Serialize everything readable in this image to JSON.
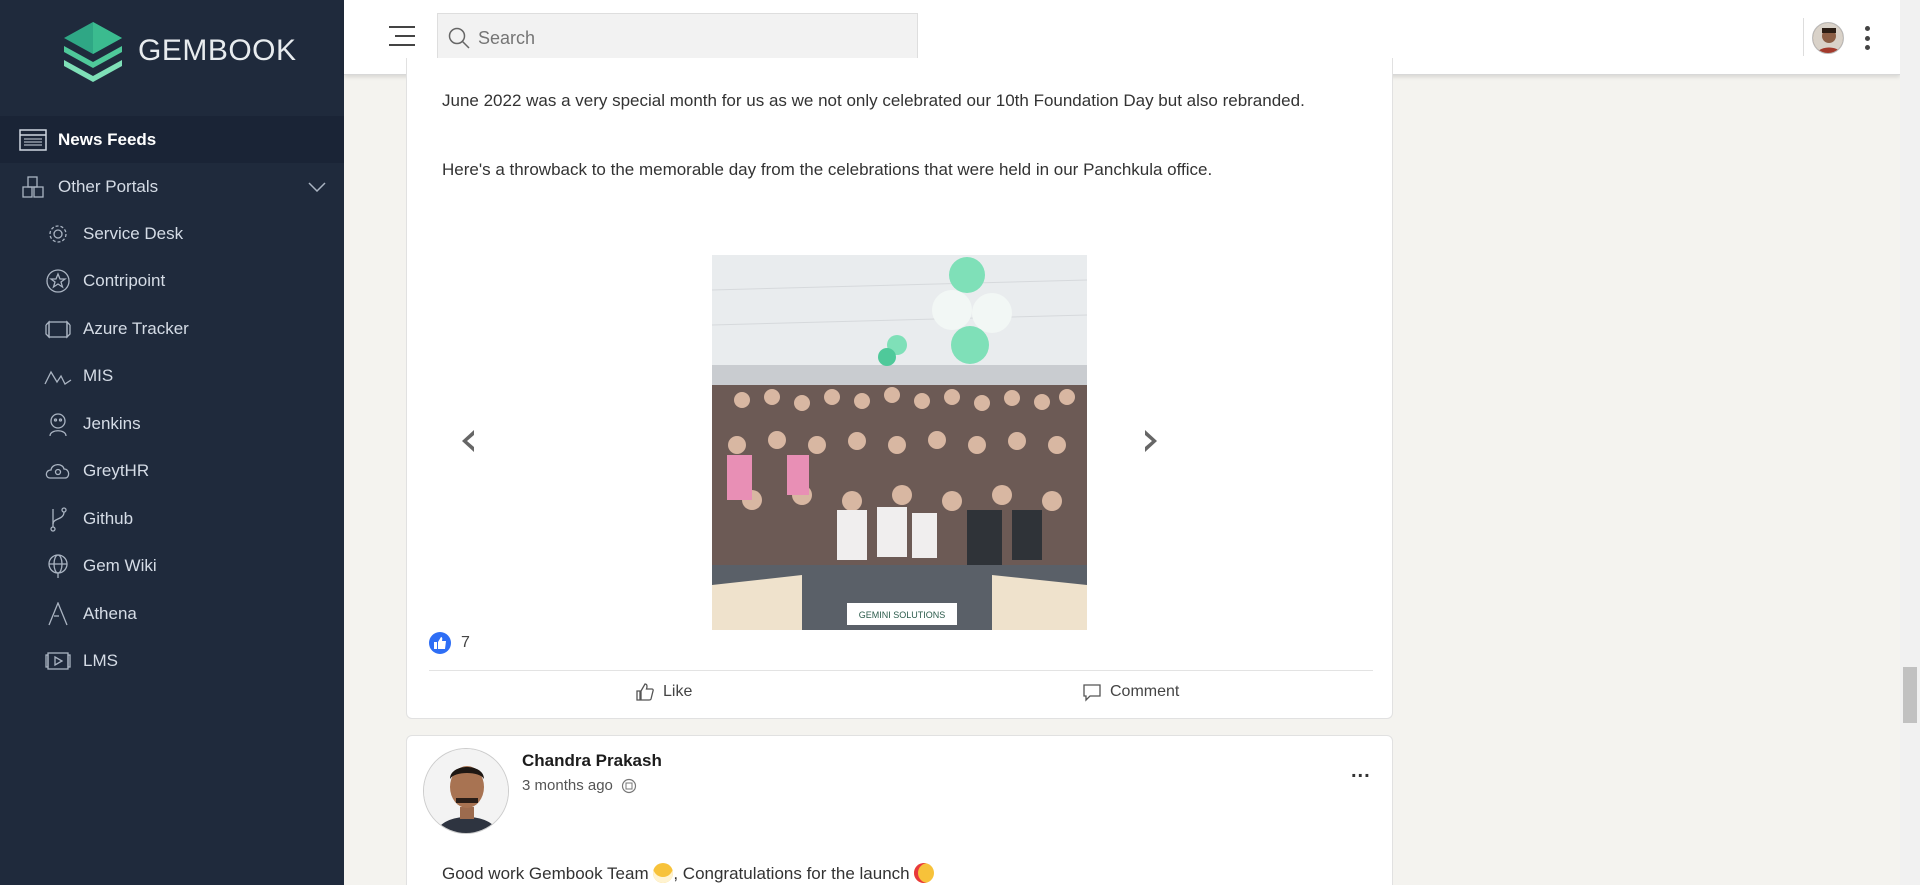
{
  "brand": {
    "name": "GEMBOOK"
  },
  "colors": {
    "sidebar_bg": "#1f2a3c",
    "active_bg": "#1a2436",
    "like_blue": "#2e6ef5",
    "logo_green": "#4fc99a"
  },
  "sidebar": {
    "items": [
      {
        "label": "News Feeds",
        "icon": "news-feed-icon",
        "active": true
      },
      {
        "label": "Other Portals",
        "icon": "portals-icon",
        "expanded": true
      },
      {
        "label": "Service Desk",
        "icon": "gear-icon"
      },
      {
        "label": "Contripoint",
        "icon": "star-icon"
      },
      {
        "label": "Azure Tracker",
        "icon": "tracker-icon"
      },
      {
        "label": "MIS",
        "icon": "chart-wave-icon"
      },
      {
        "label": "Jenkins",
        "icon": "jenkins-icon"
      },
      {
        "label": "GreytHR",
        "icon": "cloud-user-icon"
      },
      {
        "label": "Github",
        "icon": "branch-icon"
      },
      {
        "label": "Gem Wiki",
        "icon": "globe-icon"
      },
      {
        "label": "Athena",
        "icon": "triangle-icon"
      },
      {
        "label": "LMS",
        "icon": "play-screen-icon"
      }
    ]
  },
  "header": {
    "search_placeholder": "Search"
  },
  "posts": [
    {
      "paragraphs": [
        "June 2022 was a very special month for us as we not only celebrated our 10th Foundation Day but also rebranded.",
        "Here's a throwback to the memorable day from the celebrations that were held in our Panchkula office."
      ],
      "image_caption": "GEMINI SOLUTIONS",
      "like_count": "7",
      "like_label": "Like",
      "comment_label": "Comment"
    },
    {
      "author": "Chandra Prakash",
      "time": "3 months ago",
      "more": "...",
      "text_part1": "Good work Gembook Team ",
      "text_part2": ", Congratulations for the launch "
    }
  ]
}
